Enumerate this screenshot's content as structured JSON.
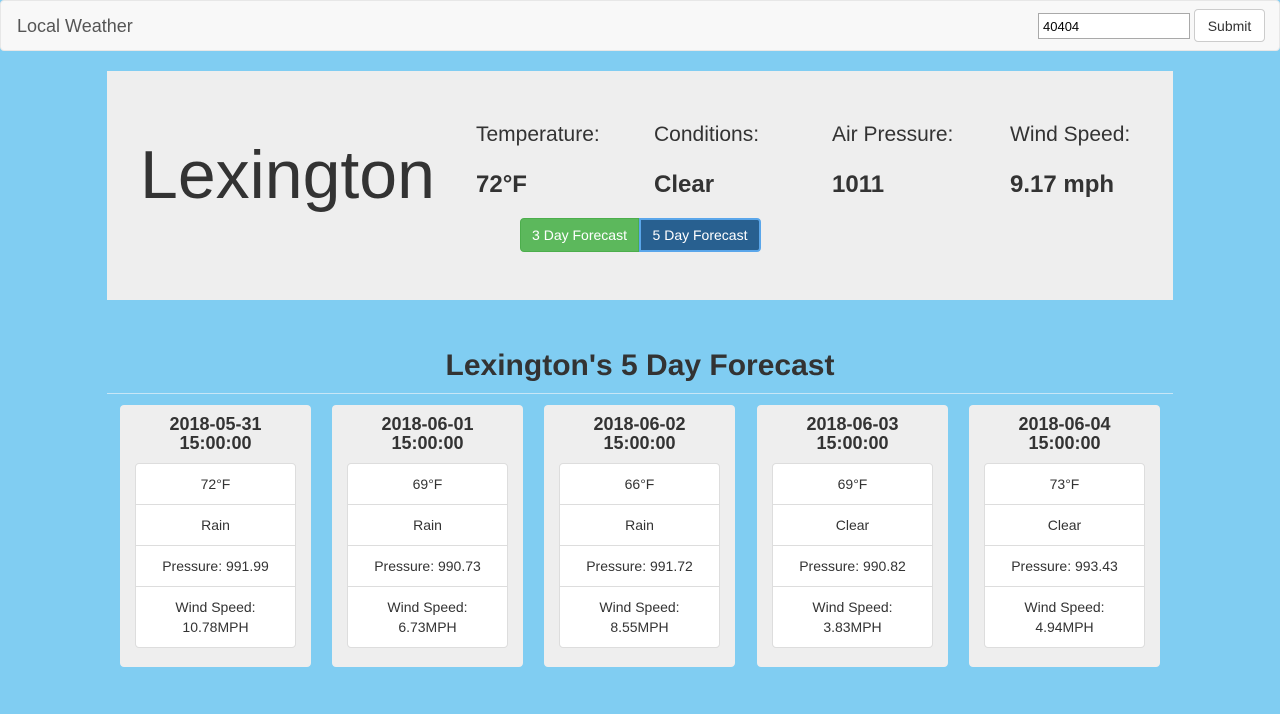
{
  "navbar": {
    "brand": "Local Weather",
    "zip_value": "40404",
    "submit_label": "Submit"
  },
  "current": {
    "city": "Lexington",
    "stats": [
      {
        "label": "Temperature:",
        "value": "72°F"
      },
      {
        "label": "Conditions:",
        "value": "Clear"
      },
      {
        "label": "Air Pressure:",
        "value": "1011"
      },
      {
        "label": "Wind Speed:",
        "value": "9.17 mph"
      }
    ],
    "btn_3day": "3 Day Forecast",
    "btn_5day": "5 Day Forecast"
  },
  "forecast": {
    "title": "Lexington's 5 Day Forecast",
    "days": [
      {
        "date": "2018-05-31",
        "time": "15:00:00",
        "temp": "72°F",
        "cond": "Rain",
        "pressure": "Pressure: 991.99",
        "wind_label": "Wind Speed:",
        "wind": "10.78MPH"
      },
      {
        "date": "2018-06-01",
        "time": "15:00:00",
        "temp": "69°F",
        "cond": "Rain",
        "pressure": "Pressure: 990.73",
        "wind_label": "Wind Speed:",
        "wind": "6.73MPH"
      },
      {
        "date": "2018-06-02",
        "time": "15:00:00",
        "temp": "66°F",
        "cond": "Rain",
        "pressure": "Pressure: 991.72",
        "wind_label": "Wind Speed:",
        "wind": "8.55MPH"
      },
      {
        "date": "2018-06-03",
        "time": "15:00:00",
        "temp": "69°F",
        "cond": "Clear",
        "pressure": "Pressure: 990.82",
        "wind_label": "Wind Speed:",
        "wind": "3.83MPH"
      },
      {
        "date": "2018-06-04",
        "time": "15:00:00",
        "temp": "73°F",
        "cond": "Clear",
        "pressure": "Pressure: 993.43",
        "wind_label": "Wind Speed:",
        "wind": "4.94MPH"
      }
    ]
  },
  "colors": {
    "page_bg": "#80cdf2",
    "panel_bg": "#eeeeee",
    "success": "#5cb85c",
    "primary_active": "#286090"
  }
}
